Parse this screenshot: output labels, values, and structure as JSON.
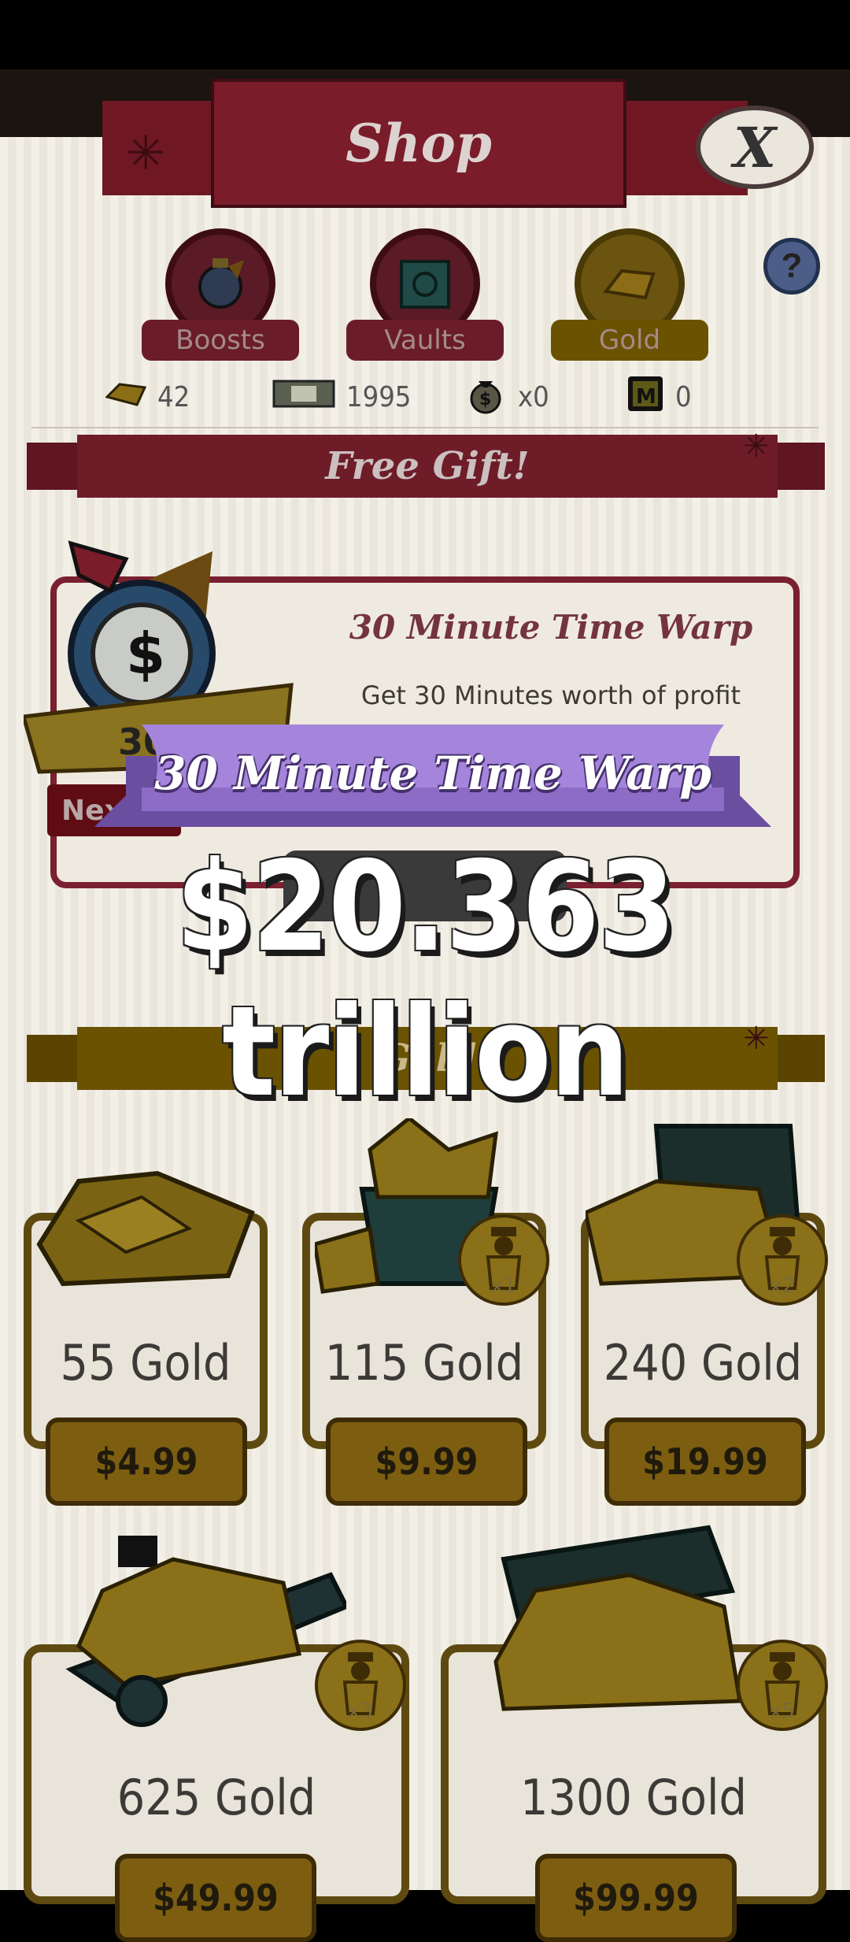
{
  "header": {
    "title": "Shop",
    "close_label": "X",
    "help_label": "?"
  },
  "tabs": [
    {
      "label": "Boosts",
      "icon": "moneybag-stopwatch-icon"
    },
    {
      "label": "Vaults",
      "icon": "vault-icon"
    },
    {
      "label": "Gold",
      "icon": "gold-bar-icon"
    }
  ],
  "currencies": [
    {
      "icon": "gold-bar-icon",
      "value": "42"
    },
    {
      "icon": "banknote-icon",
      "value": "1995"
    },
    {
      "icon": "moneybag-icon",
      "value": "x0"
    },
    {
      "icon": "megabucks-icon",
      "value": "0"
    }
  ],
  "free_gift": {
    "section_title": "Free Gift!",
    "title": "30 Minute Time Warp",
    "description": "Get 30 Minutes worth of profit",
    "next_label": "Next",
    "art_label": "30m"
  },
  "gold_section": {
    "title": "Gold",
    "items": [
      {
        "label": "55 Gold",
        "price": "$4.99",
        "multiplier": ""
      },
      {
        "label": "115 Gold",
        "price": "$9.99",
        "multiplier": "x1"
      },
      {
        "label": "240 Gold",
        "price": "$19.99",
        "multiplier": "x2"
      },
      {
        "label": "625 Gold",
        "price": "$49.99",
        "multiplier": "x3"
      },
      {
        "label": "1300 Gold",
        "price": "$99.99",
        "multiplier": "x5"
      }
    ]
  },
  "reward_popup": {
    "ribbon_title": "30 Minute Time Warp",
    "amount": "$20.363 trillion"
  },
  "colors": {
    "shop_banner": "#7a1c2a",
    "gold_banner": "#6b5200",
    "ribbon": "#9b7fd4",
    "accent_gold": "#c9a21a"
  }
}
